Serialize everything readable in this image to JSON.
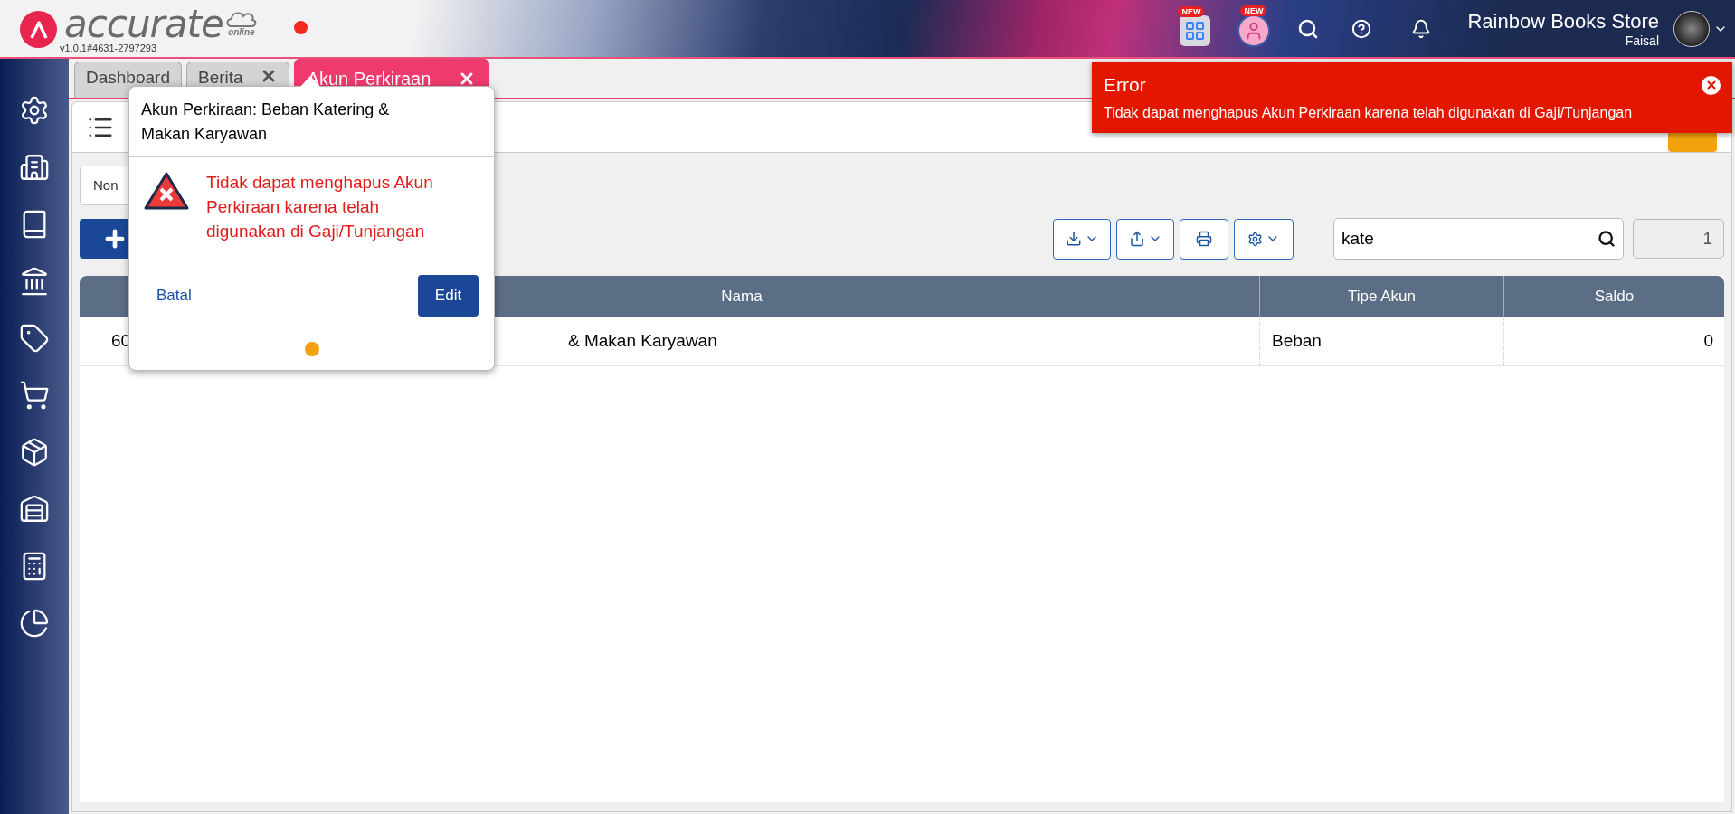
{
  "header": {
    "logo_text": "accurate",
    "logo_subtext": "online",
    "version": "v1.0.1#4631-2797293",
    "badges": [
      {
        "label": "NEW"
      },
      {
        "label": "NEW"
      }
    ],
    "company": "Rainbow Books Store",
    "user": "Faisal"
  },
  "tabs": [
    {
      "label": "Dashboard",
      "selected": false,
      "closable": false
    },
    {
      "label": "Berita",
      "selected": false,
      "closable": true
    },
    {
      "label": "Akun Perkiraan",
      "selected": true,
      "closable": true
    }
  ],
  "filter": {
    "value": "Non"
  },
  "search": {
    "value": "kate"
  },
  "page_field": {
    "value": "1"
  },
  "table": {
    "columns": [
      "Nama",
      "Tipe Akun",
      "Saldo"
    ],
    "rows": [
      {
        "column_1": "60",
        "nama": "& Makan Karyawan",
        "tipe_akun": "Beban",
        "saldo": "0"
      }
    ]
  },
  "dialog": {
    "title": "Akun Perkiraan: Beban Katering & Makan Karyawan",
    "message": "Tidak dapat menghapus Akun Perkiraan karena telah digunakan di Gaji/Tunjangan",
    "cancel": "Batal",
    "confirm": "Edit"
  },
  "toast": {
    "title": "Error",
    "message": "Tidak dapat menghapus Akun Perkiraan karena telah digunakan di Gaji/Tunjangan"
  }
}
